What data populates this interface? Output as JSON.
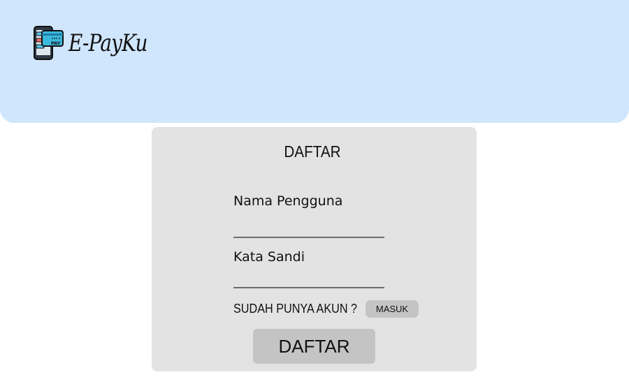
{
  "header": {
    "brand": "E-PayKu",
    "logo_icon": "phone-pay-card-icon",
    "background_color": "#d0e6fd"
  },
  "register_form": {
    "title": "DAFTAR",
    "username_label": "Nama Pengguna",
    "username_value": "",
    "password_label": "Kata Sandi",
    "password_value": "",
    "have_account_prompt": "SUDAH PUNYA AKUN ?",
    "login_button_label": "MASUK",
    "submit_button_label": "DAFTAR",
    "card_color": "#e3e3e3",
    "button_color": "#c4c4c4"
  }
}
